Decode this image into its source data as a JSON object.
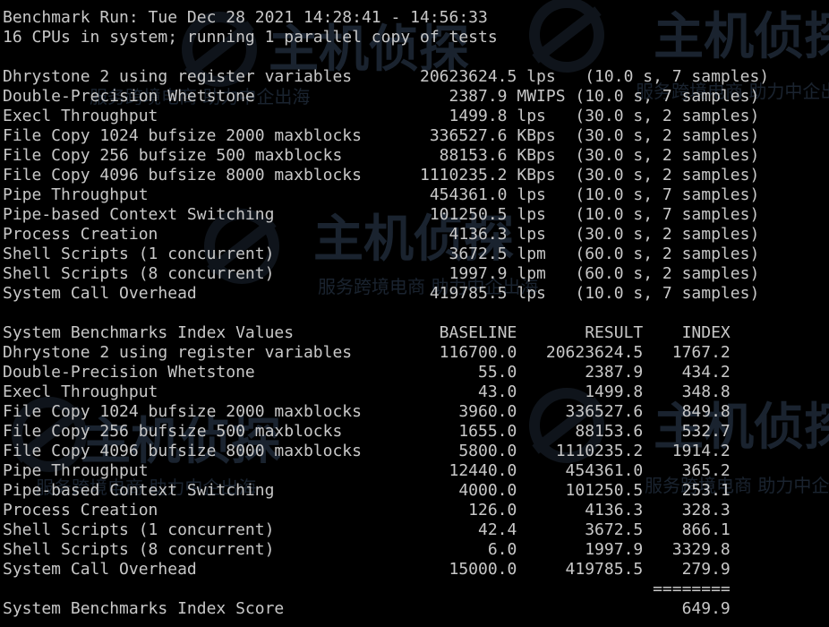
{
  "colors": {
    "background": "#000000",
    "text": "#c8c8c8",
    "watermark": "#5d7fa8"
  },
  "watermark": {
    "main": "主机侦探",
    "slogan": "服务跨境电商 助力中企出海",
    "icon": "watermark-logo-icon"
  },
  "terminal": {
    "lines": [
      "Benchmark Run: Tue Dec 28 2021 14:28:41 - 14:56:33",
      "16 CPUs in system; running 1 parallel copy of tests",
      "",
      "Dhrystone 2 using register variables       20623624.5 lps   (10.0 s, 7 samples)",
      "Double-Precision Whetstone                    2387.9 MWIPS (10.0 s, 7 samples)",
      "Execl Throughput                              1499.8 lps   (30.0 s, 2 samples)",
      "File Copy 1024 bufsize 2000 maxblocks       336527.6 KBps  (30.0 s, 2 samples)",
      "File Copy 256 bufsize 500 maxblocks          88153.6 KBps  (30.0 s, 2 samples)",
      "File Copy 4096 bufsize 8000 maxblocks      1110235.2 KBps  (30.0 s, 2 samples)",
      "Pipe Throughput                             454361.0 lps   (10.0 s, 7 samples)",
      "Pipe-based Context Switching                101250.5 lps   (10.0 s, 7 samples)",
      "Process Creation                              4136.3 lps   (30.0 s, 2 samples)",
      "Shell Scripts (1 concurrent)                  3672.5 lpm   (60.0 s, 2 samples)",
      "Shell Scripts (8 concurrent)                  1997.9 lpm   (60.0 s, 2 samples)",
      "System Call Overhead                        419785.5 lps   (10.0 s, 7 samples)",
      "",
      "System Benchmarks Index Values               BASELINE       RESULT    INDEX",
      "Dhrystone 2 using register variables         116700.0   20623624.5   1767.2",
      "Double-Precision Whetstone                       55.0       2387.9    434.2",
      "Execl Throughput                                 43.0       1499.8    348.8",
      "File Copy 1024 bufsize 2000 maxblocks          3960.0     336527.6    849.8",
      "File Copy 256 bufsize 500 maxblocks            1655.0      88153.6    532.7",
      "File Copy 4096 bufsize 8000 maxblocks          5800.0    1110235.2   1914.2",
      "Pipe Throughput                               12440.0     454361.0    365.2",
      "Pipe-based Context Switching                   4000.0     101250.5    253.1",
      "Process Creation                                126.0       4136.3    328.3",
      "Shell Scripts (1 concurrent)                     42.4       3672.5    866.1",
      "Shell Scripts (8 concurrent)                      6.0       1997.9   3329.8",
      "System Call Overhead                          15000.0     419785.5    279.9",
      "                                                                   ========",
      "System Benchmarks Index Score                                         649.9"
    ]
  }
}
